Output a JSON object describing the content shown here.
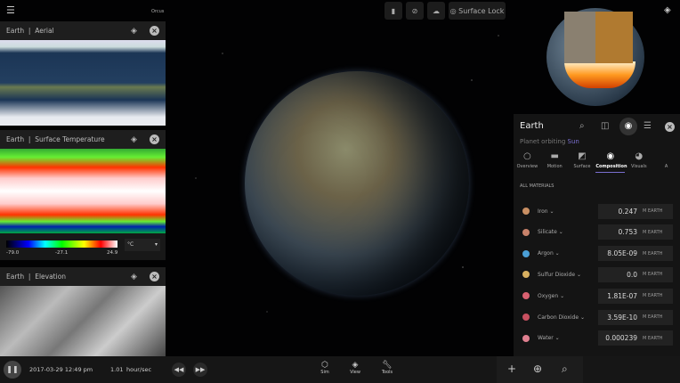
{
  "top": {
    "label_orcus": "Orcus",
    "surface_lock": "Surface Lock"
  },
  "panels": [
    {
      "body": "Earth",
      "view": "Aerial"
    },
    {
      "body": "Earth",
      "view": "Surface Temperature",
      "legend": {
        "min": "-79.0",
        "mid": "-27.1",
        "max": "24.9",
        "unit": "°C"
      }
    },
    {
      "body": "Earth",
      "view": "Elevation"
    }
  ],
  "info": {
    "title": "Earth",
    "subtitle_prefix": "Planet orbiting ",
    "subtitle_link": "Sun",
    "tabs": [
      {
        "label": "Overview",
        "icon": "○"
      },
      {
        "label": "Motion",
        "icon": "▬"
      },
      {
        "label": "Surface",
        "icon": "◩"
      },
      {
        "label": "Composition",
        "icon": "◉"
      },
      {
        "label": "Visuals",
        "icon": "◕"
      },
      {
        "label": "A",
        "icon": ""
      }
    ],
    "section": "ALL MATERIALS",
    "unit": "M EARTH",
    "materials": [
      {
        "name": "Iron",
        "value": "0.247",
        "color": "#c98f63"
      },
      {
        "name": "Silicate",
        "value": "0.753",
        "color": "#c8826a"
      },
      {
        "name": "Argon",
        "value": "8.05E-09",
        "color": "#4a9fd6"
      },
      {
        "name": "Sulfur Dioxide",
        "value": "0.0",
        "color": "#d8b060"
      },
      {
        "name": "Oxygen",
        "value": "1.81E-07",
        "color": "#d86070"
      },
      {
        "name": "Carbon Dioxide",
        "value": "3.59E-10",
        "color": "#c85060"
      },
      {
        "name": "Water",
        "value": "0.000239",
        "color": "#e08090"
      }
    ]
  },
  "bottom": {
    "date": "2017-03-29 12:49 pm",
    "rate": "1.01",
    "rate_unit": "hour/sec",
    "sim": "Sim",
    "view": "View",
    "tools": "Tools"
  }
}
